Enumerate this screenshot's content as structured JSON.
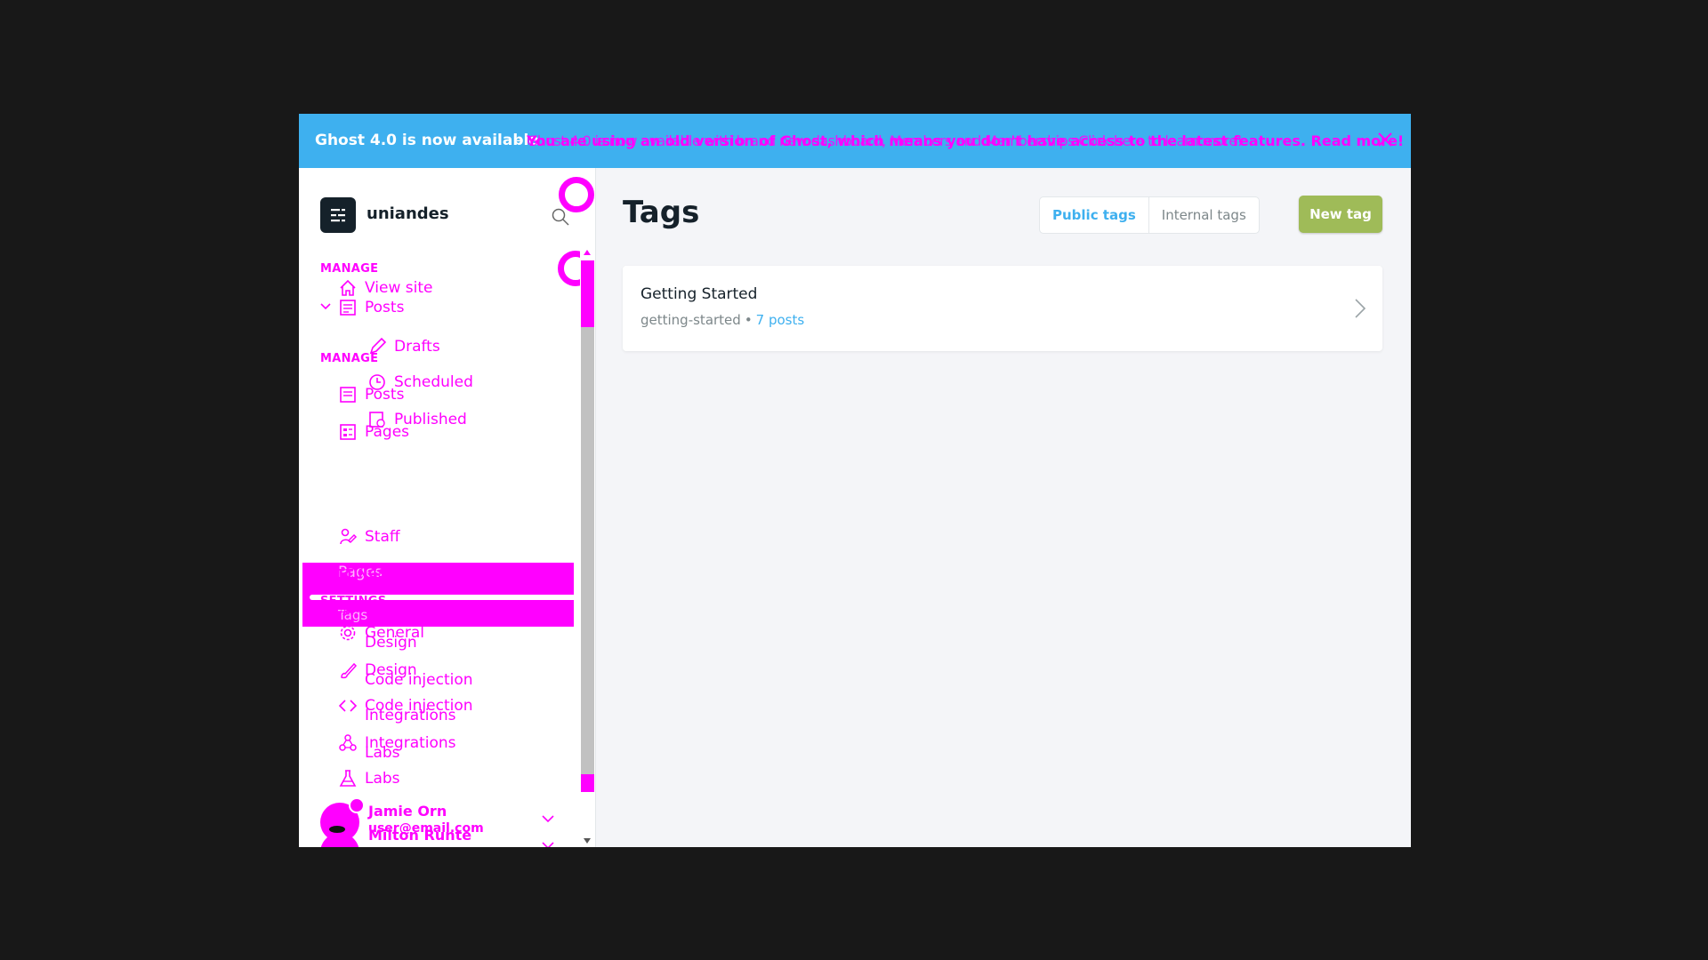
{
  "banner": {
    "title": "Ghost 4.0 is now available",
    "dash": "-",
    "message": "You are using an old version of Ghost, which means you don't have access to the latest features. Read more!",
    "message_overlay": "Ghost 4.0 is now available with brand new dashboard, Members and Memberships Click here to learn more!"
  },
  "brand": {
    "name": "uniandes"
  },
  "sidebar": {
    "manage_label": "MANAGE",
    "manage_label_dup": "MANAGE",
    "items": {
      "view_site": "View site",
      "posts": "Posts",
      "drafts": "Drafts",
      "scheduled": "Scheduled",
      "published": "Published",
      "posts_dup": "Posts",
      "pages": "Pages",
      "pages_dup": "Pages",
      "tags": "Tags",
      "staff": "Staff"
    },
    "settings_label": "SETTINGS",
    "settings_label_dup": "SETTINGS",
    "settings_items": {
      "general": "General",
      "general_dup": "General",
      "design": "Design",
      "design_dup": "Design",
      "code_injection": "Code injection",
      "code_injection_dup": "Code injection",
      "integrations": "Integrations",
      "integrations_dup": "Integrations",
      "labs": "Labs",
      "labs_dup": "Labs"
    },
    "user": {
      "name": "Jamie Orn",
      "email": "user@email.com",
      "name_dup": "Milton Runte"
    }
  },
  "main": {
    "title": "Tags",
    "tabs": [
      "Public tags",
      "Internal tags"
    ],
    "new_button": "New tag",
    "tags": [
      {
        "name": "Getting Started",
        "slug": "getting-started",
        "count": "7 posts"
      }
    ]
  },
  "colors": {
    "banner": "#3eb0ef",
    "accent": "#3eb0ef",
    "new_button": "#9fbb58",
    "overlay_magenta": "#ff00ff"
  }
}
